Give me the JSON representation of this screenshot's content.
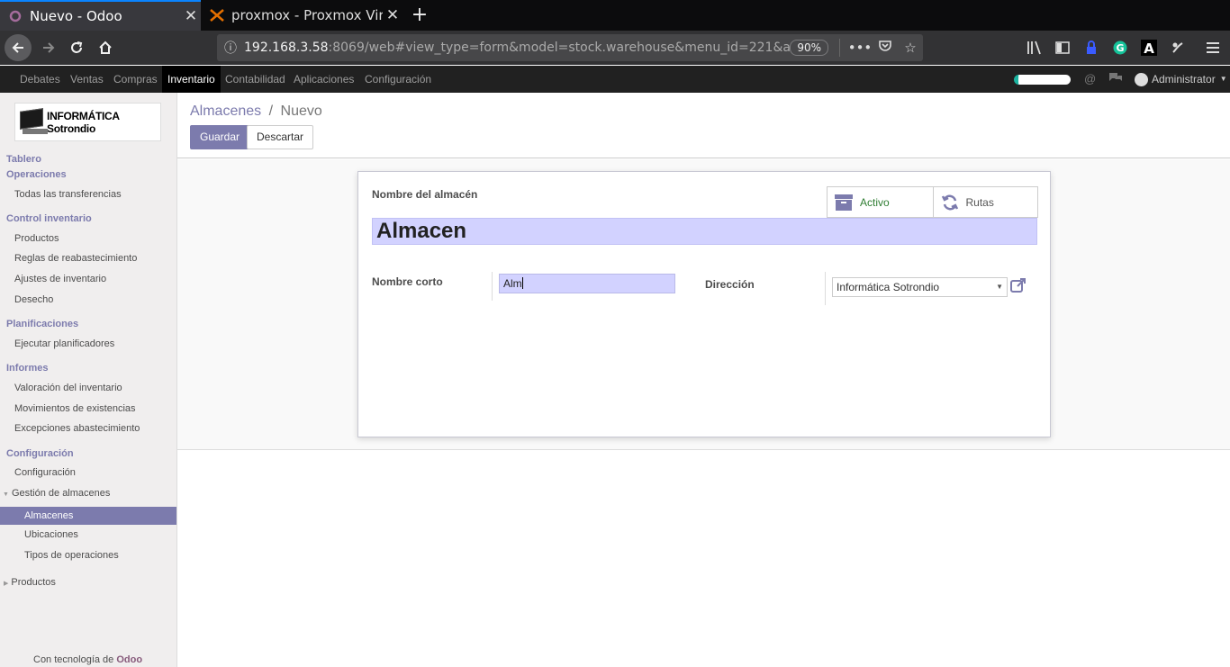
{
  "browser": {
    "tabs": [
      {
        "title": "Nuevo - Odoo",
        "active": true
      },
      {
        "title": "proxmox - Proxmox Virt",
        "active": false
      }
    ],
    "url_host": "192.168.3.58",
    "url_rest": ":8069/web#view_type=form&model=stock.warehouse&menu_id=221&ac",
    "zoom": "90%"
  },
  "topmenu": {
    "items": [
      "Debates",
      "Ventas",
      "Compras",
      "Inventario",
      "Contabilidad",
      "Aplicaciones",
      "Configuración"
    ],
    "active": "Inventario",
    "user": "Administrator"
  },
  "sidebar": {
    "logo_text": "INFORMÁTICA Sotrondio",
    "sections": {
      "tablero": "Tablero",
      "operaciones": "Operaciones",
      "todas_transferencias": "Todas las transferencias",
      "control_inventario": "Control inventario",
      "productos": "Productos",
      "reglas": "Reglas de reabastecimiento",
      "ajustes": "Ajustes de inventario",
      "desecho": "Desecho",
      "planificaciones": "Planificaciones",
      "ejecutar": "Ejecutar planificadores",
      "informes": "Informes",
      "valoracion": "Valoración del inventario",
      "movimientos": "Movimientos de existencias",
      "excepciones": "Excepciones abastecimiento",
      "configuracion_h": "Configuración",
      "configuracion": "Configuración",
      "gestion": "Gestión de almacenes",
      "almacenes": "Almacenes",
      "ubicaciones": "Ubicaciones",
      "tipos": "Tipos de operaciones",
      "productos2": "Productos"
    },
    "powered_prefix": "Con tecnología de ",
    "powered_brand": "Odoo"
  },
  "control_panel": {
    "breadcrumb_parent": "Almacenes",
    "breadcrumb_sep": "/",
    "breadcrumb_current": "Nuevo",
    "save_label": "Guardar",
    "discard_label": "Descartar"
  },
  "form": {
    "name_label": "Nombre del almacén",
    "name_value": "Almacen",
    "stat_active": "Activo",
    "stat_routes": "Rutas",
    "short_label": "Nombre corto",
    "short_value": "Alm",
    "address_label": "Dirección",
    "address_value": "Informática Sotrondio"
  },
  "colors": {
    "odoo_primary": "#7c7bad",
    "field_highlight": "#d2d2ff",
    "active_green": "#2f7d32"
  }
}
